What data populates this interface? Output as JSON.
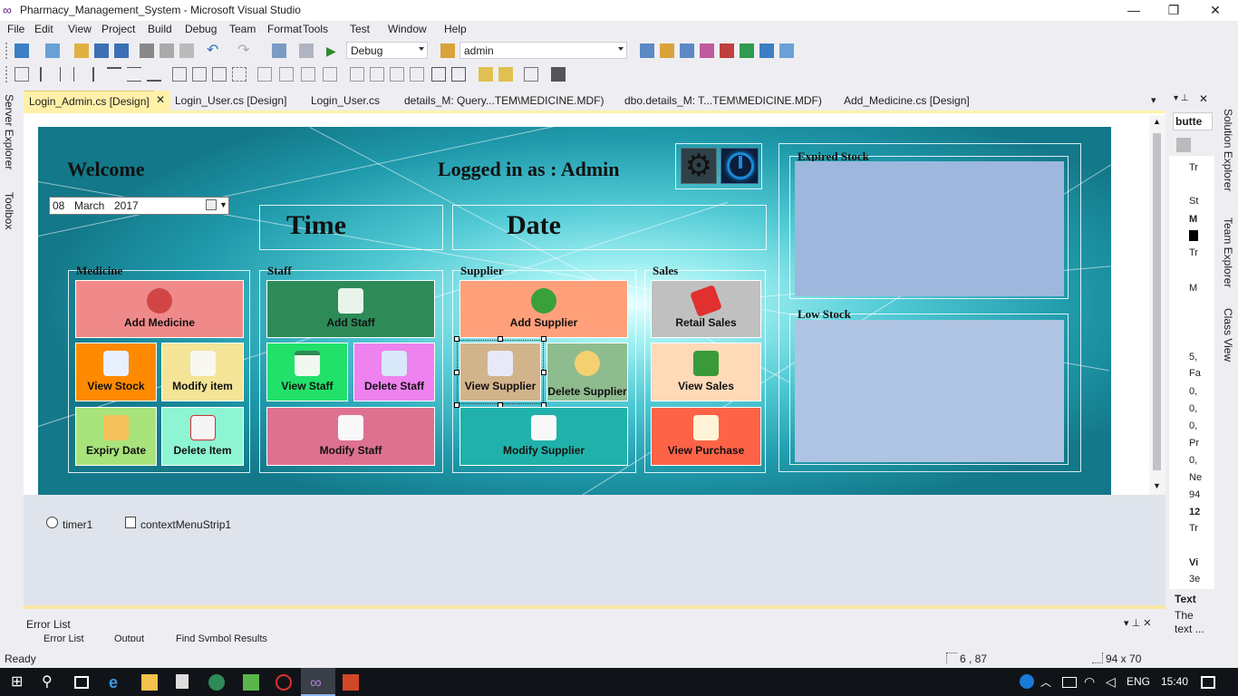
{
  "window": {
    "title": "Pharmacy_Management_System - Microsoft Visual Studio",
    "minimize": "—",
    "restore": "❐",
    "close": "✕"
  },
  "menu": [
    "File",
    "Edit",
    "View",
    "Project",
    "Build",
    "Debug",
    "Team",
    "Format",
    "Tools",
    "Test",
    "Window",
    "Help"
  ],
  "toolbar": {
    "config": "Debug",
    "search": "admin"
  },
  "tabs": [
    {
      "label": "Login_Admin.cs [Design]",
      "active": true
    },
    {
      "label": "Login_User.cs [Design]"
    },
    {
      "label": "Login_User.cs"
    },
    {
      "label": "details_M: Query...TEM\\MEDICINE.MDF)"
    },
    {
      "label": "dbo.details_M: T...TEM\\MEDICINE.MDF)"
    },
    {
      "label": "Add_Medicine.cs [Design]"
    }
  ],
  "form": {
    "welcome": "Welcome",
    "logged_in": "Logged in as : Admin",
    "date_picker": {
      "day": "08",
      "month": "March",
      "year": "2017"
    },
    "time_label": "Time",
    "date_label": "Date",
    "groups": {
      "medicine": "Medicine",
      "staff": "Staff",
      "supplier": "Supplier",
      "sales": "Sales",
      "expired": "Expired Stock",
      "low": "Low Stock"
    },
    "buttons": {
      "add_medicine": "Add Medicine",
      "view_stock": "View Stock",
      "modify_item": "Modify item",
      "expiry_date": "Expiry Date",
      "delete_item": "Delete Item",
      "add_staff": "Add Staff",
      "view_staff": "View Staff",
      "delete_staff": "Delete Staff",
      "modify_staff": "Modify Staff",
      "add_supplier": "Add Supplier",
      "view_supplier": "View Supplier",
      "delete_supplier": "Delete Supplier",
      "modify_supplier": "Modify Supplier",
      "retail_sales": "Retail Sales",
      "view_sales": "View Sales",
      "view_purchase": "View Purchase"
    }
  },
  "tray": {
    "timer": "timer1",
    "context_menu": "contextMenuStrip1"
  },
  "left_sidebar": [
    "Server Explorer",
    "Toolbox"
  ],
  "right_sidebar": [
    "Solution Explorer",
    "Team Explorer",
    "Class View"
  ],
  "properties": {
    "combo": "butte",
    "text_label": "Text",
    "text_desc1": "The",
    "text_desc2": "text ...",
    "snippets": [
      "Tr",
      "St",
      "M",
      "Tr",
      "M",
      "5,",
      "Fa",
      "0,",
      "0,",
      "0,",
      "Pr",
      "0,",
      "Ne",
      "94",
      "12",
      "Tr",
      "Vi",
      "3e"
    ]
  },
  "errorlist": {
    "title": "Error List",
    "tabs": [
      "Error List",
      "Output",
      "Find Symbol Results"
    ]
  },
  "statusbar": {
    "ready": "Ready",
    "position": "6 , 87",
    "size": "94 x 70"
  },
  "taskbar": {
    "lang": "ENG",
    "time": "15:40"
  },
  "colors": {
    "add_medicine": "#f08a8a",
    "view_stock": "#ff8a00",
    "modify_item": "#f3e497",
    "expiry_date": "#a8e37b",
    "delete_item": "#8ef5d3",
    "add_staff": "#2e8b57",
    "view_staff": "#22e06a",
    "delete_staff": "#ee82ee",
    "modify_staff": "#de7190",
    "add_supplier": "#ffa07a",
    "view_supplier": "#d2b48c",
    "delete_supplier": "#8fbc8f",
    "modify_supplier": "#20b2aa",
    "retail_sales": "#c0c0c0",
    "view_sales": "#ffdab9",
    "view_purchase": "#ff6347"
  }
}
